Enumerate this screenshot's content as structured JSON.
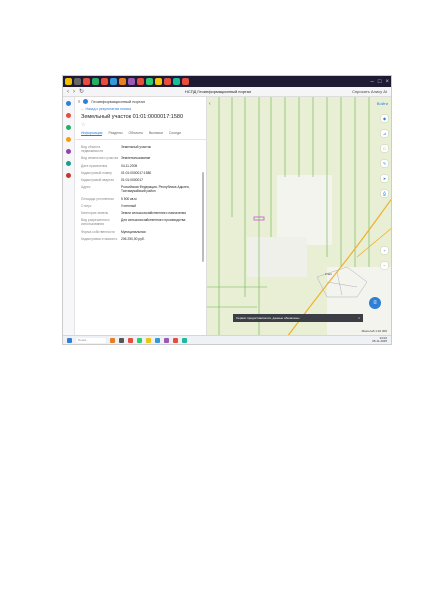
{
  "browser": {
    "url": "НСПД Геоинформационный портал",
    "ai_label": "Спросить Алису AI"
  },
  "panel": {
    "portal_title": "Геоинформационный портал",
    "back_link": "← Назад к результатам поиска",
    "object_title": "Земельный участок 01:01:0000017:1580",
    "tabs": [
      "Информация",
      "Разделы",
      "Объекты",
      "Выписки",
      "Соседи"
    ],
    "rows": [
      {
        "k": "Вид объекта недвижимости",
        "v": "Земельный участок"
      },
      {
        "k": "Вид земельного участка",
        "v": "Землепользование"
      },
      {
        "k": "Дата присвоения",
        "v": "04.11.2005"
      },
      {
        "k": "Кадастровый номер",
        "v": "01:01:0000017:1580"
      },
      {
        "k": "Кадастровый квартал",
        "v": "01:01:0000017"
      },
      {
        "k": "Адрес",
        "v": "Российская Федерация, Республика Адыгея, Тахтамукайский район"
      },
      {
        "k": "Площадь уточненная",
        "v": "5 500 кв.м"
      },
      {
        "k": "Статус",
        "v": "Учтенный"
      },
      {
        "k": "Категория земель",
        "v": "Земли сельскохозяйственного назначения"
      },
      {
        "k": "Вид разрешенного использования",
        "v": "Для сельскохозяйственного производства"
      },
      {
        "k": "Форма собственности",
        "v": "Муниципальная"
      },
      {
        "k": "Кадастровая стоимость",
        "v": "206 250,00 руб."
      }
    ]
  },
  "map": {
    "login": "Войти",
    "village": "Уляп",
    "toast": "Сервис предоставляется, данные обновлены",
    "toast_close": "×",
    "scale": "Масштаб 1:10 000"
  },
  "taskbar": {
    "search_placeholder": "Поиск",
    "time": "13:02",
    "date": "05.11.2025"
  },
  "colors": {
    "accent": "#2e7fd6",
    "map_bg": "#e8efd4",
    "field_line": "#68b24b"
  }
}
